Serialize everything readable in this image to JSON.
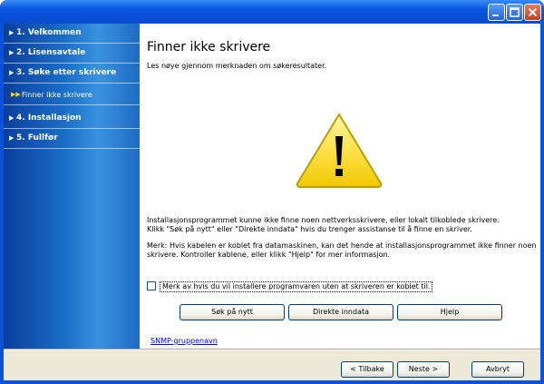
{
  "sidebar": {
    "steps": [
      {
        "label": "1. Velkommen"
      },
      {
        "label": "2. Lisensavtale"
      },
      {
        "label": "3. Søke etter skrivere"
      },
      {
        "label": "4. Installasjon"
      },
      {
        "label": "5. Fullfør"
      }
    ],
    "current_substep": "Finner ikke skrivere"
  },
  "main": {
    "title": "Finner ikke skrivere",
    "intro": "Les nøye gjennom merknaden om søkeresultater.",
    "message_lines": [
      "Installasjonsprogrammet kunne ikke finne noen nettverksskrivere, eller lokalt tilkoblede skrivere.",
      "Klikk \"Søk på nytt\" eller \"Direkte inndata\" hvis du trenger assistanse til å finne en skriver."
    ],
    "note_lines": [
      "Merk: Hvis kabelen er koblet fra datamaskinen, kan det hende at installasjonsprogrammet ikke finner noen",
      "skrivere. Kontroller kablene, eller klikk \"Hjelp\" for mer informasjon."
    ],
    "checkbox_label": "Merk av hvis du vil installere programvaren uten at skriveren er koblet til.",
    "checkbox_checked": false,
    "buttons": {
      "search_again": "Søk på nytt",
      "direct_input": "Direkte inndata",
      "help": "Hjelp"
    },
    "snmp_link": "SNMP-gruppenavn"
  },
  "footer": {
    "back": "< Tilbake",
    "next": "Neste >",
    "cancel": "Avbryt"
  },
  "colors": {
    "warning_fill": "#ffe14a",
    "warning_border": "#b8a000",
    "sidebar_blue": "#1a6ec8"
  }
}
